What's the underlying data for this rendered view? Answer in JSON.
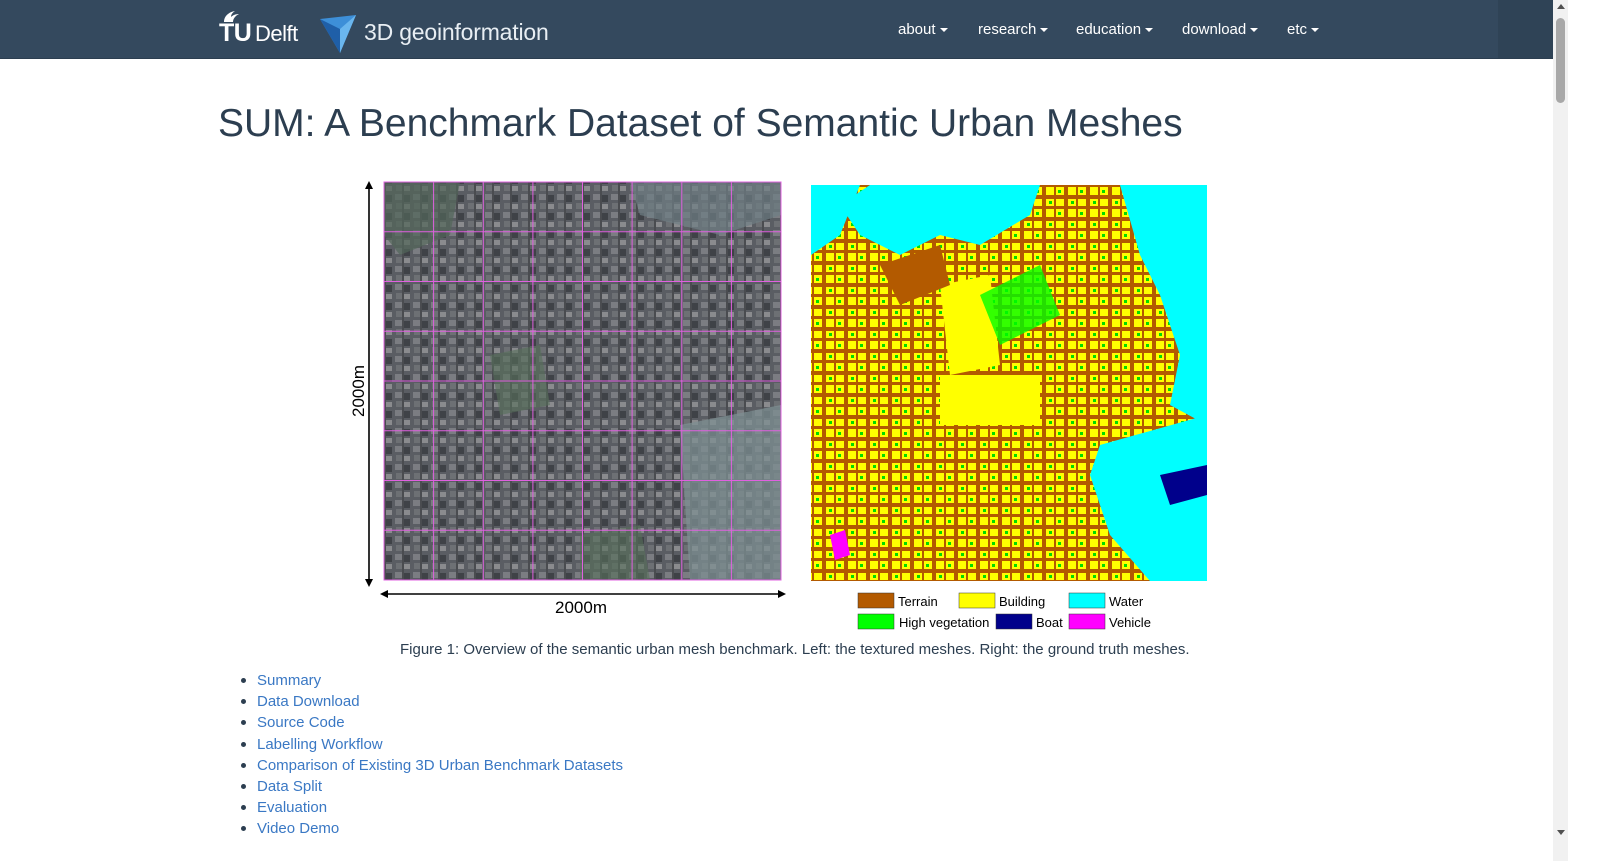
{
  "brand": {
    "university": "TU",
    "university_suffix": "Delft",
    "group": "3D geoinformation"
  },
  "nav": {
    "items": [
      {
        "label": "about"
      },
      {
        "label": "research"
      },
      {
        "label": "education"
      },
      {
        "label": "download"
      },
      {
        "label": "etc"
      }
    ]
  },
  "page": {
    "title": "SUM: A Benchmark Dataset of Semantic Urban Meshes"
  },
  "figure": {
    "left_vertical_label": "2000m",
    "left_horizontal_label": "2000m",
    "legend": [
      {
        "label": "Terrain",
        "color": "#b35a00"
      },
      {
        "label": "Building",
        "color": "#ffff00"
      },
      {
        "label": "Water",
        "color": "#00ffff"
      },
      {
        "label": "High vegetation",
        "color": "#00ff00"
      },
      {
        "label": "Boat",
        "color": "#00008b"
      },
      {
        "label": "Vehicle",
        "color": "#ff00ff"
      }
    ],
    "caption": "Figure 1: Overview of the semantic urban mesh benchmark. Left: the textured meshes. Right: the ground truth meshes."
  },
  "toc": {
    "items": [
      {
        "label": "Summary"
      },
      {
        "label": "Data Download"
      },
      {
        "label": "Source Code"
      },
      {
        "label": "Labelling Workflow"
      },
      {
        "label": "Comparison of Existing 3D Urban Benchmark Datasets"
      },
      {
        "label": "Data Split"
      },
      {
        "label": "Evaluation"
      },
      {
        "label": "Video Demo"
      }
    ]
  },
  "colors": {
    "navbar": "#34495e",
    "link": "#3a78c4",
    "title": "#2c3e50",
    "grid_tile": "#e060e0"
  }
}
